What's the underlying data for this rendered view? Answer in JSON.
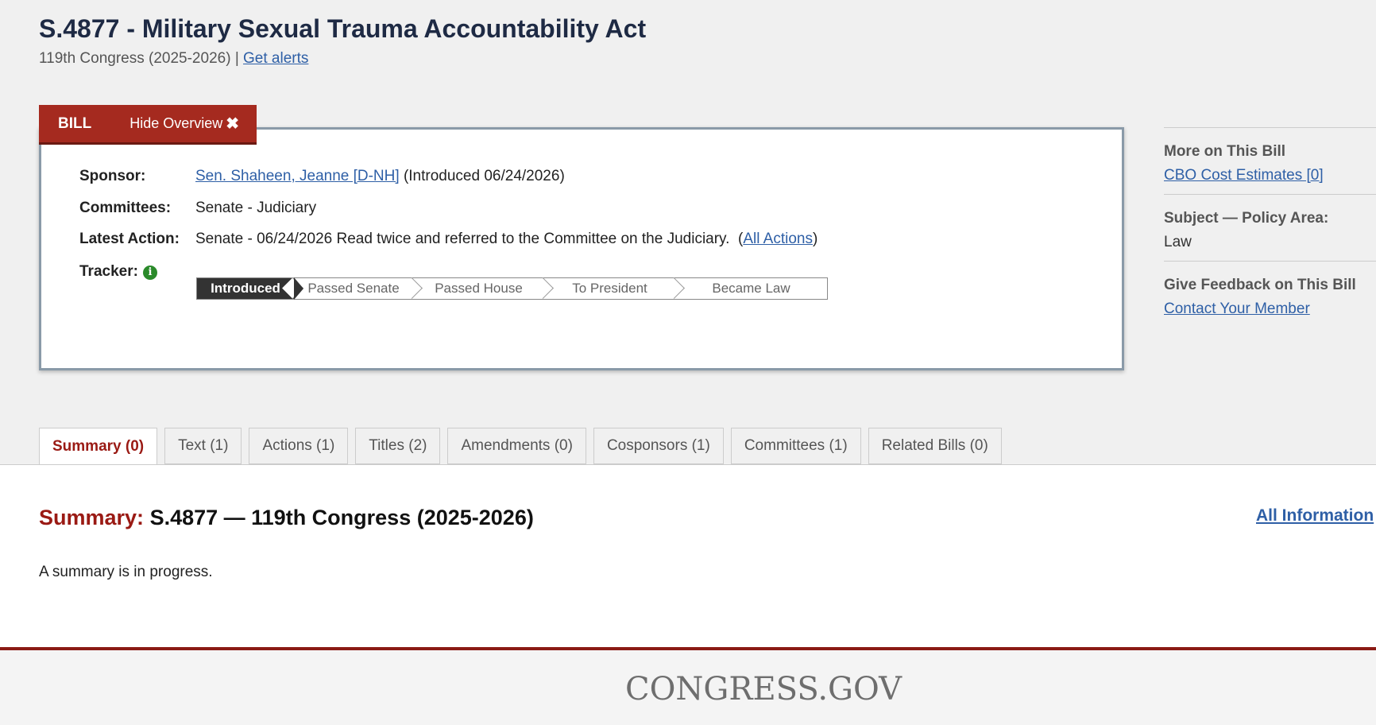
{
  "header": {
    "title": "S.4877 - Military Sexual Trauma Accountability Act",
    "congress": "119th Congress (2025-2026)",
    "separator": "|",
    "alerts_link": "Get alerts"
  },
  "bill_tab": {
    "label": "BILL",
    "hide_overview": "Hide Overview",
    "close_glyph": "✖"
  },
  "overview": {
    "sponsor_label": "Sponsor:",
    "sponsor_name": "Sen. Shaheen, Jeanne [D-NH]",
    "sponsor_intro": "(Introduced 06/24/2026)",
    "committees_label": "Committees:",
    "committees_value": "Senate - Judiciary",
    "latest_action_label": "Latest Action:",
    "latest_action_value": "Senate - 06/24/2026 Read twice and referred to the Committee on the Judiciary.",
    "all_actions_open": "(",
    "all_actions_link": "All Actions",
    "all_actions_close": ")",
    "tracker_label": "Tracker:",
    "tracker_icon": "i",
    "tracker_steps": [
      "Introduced",
      "Passed Senate",
      "Passed House",
      "To President",
      "Became Law"
    ],
    "tracker_current": "Introduced"
  },
  "sidebar": {
    "more_title": "More on This Bill",
    "cbo_link": "CBO Cost Estimates [0]",
    "subject_title": "Subject — Policy Area:",
    "subject_value": "Law",
    "feedback_title": "Give Feedback on This Bill",
    "contact_link": "Contact Your Member"
  },
  "tabs": [
    {
      "label": "Summary (0)",
      "active": true
    },
    {
      "label": "Text (1)"
    },
    {
      "label": "Actions (1)"
    },
    {
      "label": "Titles (2)"
    },
    {
      "label": "Amendments (0)"
    },
    {
      "label": "Cosponsors (1)"
    },
    {
      "label": "Committees (1)"
    },
    {
      "label": "Related Bills (0)"
    }
  ],
  "summary": {
    "heading_prefix": "Summary:",
    "heading_rest": "S.4877 — 119th Congress (2025-2026)",
    "all_information": "All Information",
    "text": "A summary is in progress."
  },
  "footer": {
    "logo": "CONGRESS.GOV"
  },
  "colors": {
    "accent_red": "#a52a1f",
    "link_blue": "#2e5fa6",
    "title_navy": "#1e2a44",
    "tracker_dark": "#333333",
    "info_green": "#2a8a2a"
  }
}
